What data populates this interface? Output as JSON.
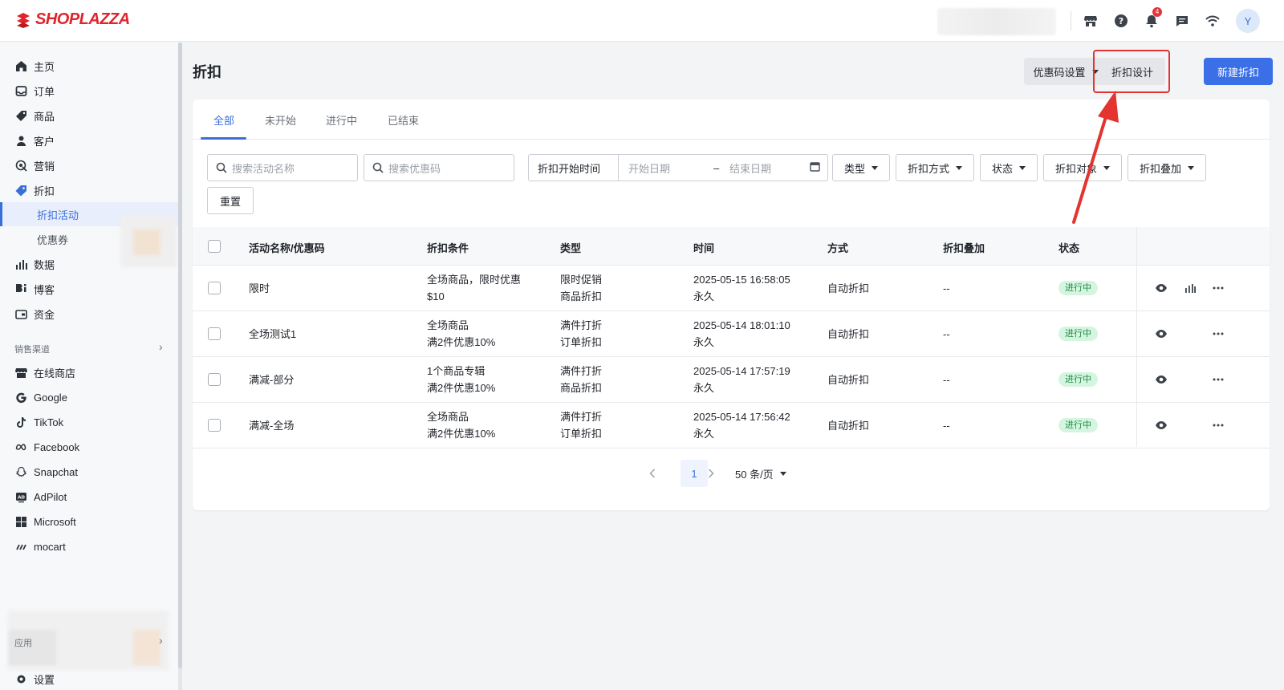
{
  "brand": {
    "name": "SHOPLAZZA",
    "color": "#e0242c"
  },
  "topbar": {
    "icons": [
      "store-icon",
      "help-icon",
      "bell-icon",
      "chat-icon",
      "wifi-icon"
    ],
    "notifications": "4",
    "avatar": "Y"
  },
  "sidebar": {
    "items": [
      {
        "label": "主页",
        "icon": "home-icon"
      },
      {
        "label": "订单",
        "icon": "inbox-icon"
      },
      {
        "label": "商品",
        "icon": "tag-icon"
      },
      {
        "label": "客户",
        "icon": "person-icon"
      },
      {
        "label": "营销",
        "icon": "target-icon"
      },
      {
        "label": "折扣",
        "icon": "discount-icon"
      },
      {
        "label": "折扣活动"
      },
      {
        "label": "优惠券"
      },
      {
        "label": "数据",
        "icon": "bar-chart-icon"
      },
      {
        "label": "博客",
        "icon": "blog-icon"
      },
      {
        "label": "资金",
        "icon": "wallet-icon"
      }
    ],
    "channels_label": "销售渠道",
    "channels": [
      {
        "label": "在线商店",
        "icon": "store-icon"
      },
      {
        "label": "Google",
        "icon": "google-icon"
      },
      {
        "label": "TikTok",
        "icon": "tiktok-icon"
      },
      {
        "label": "Facebook",
        "icon": "meta-icon"
      },
      {
        "label": "Snapchat",
        "icon": "snapchat-icon"
      },
      {
        "label": "AdPilot",
        "icon": "adpilot-icon"
      },
      {
        "label": "Microsoft",
        "icon": "microsoft-icon"
      },
      {
        "label": "mocart",
        "icon": "mocart-icon"
      }
    ],
    "apps_label": "应用",
    "settings_label": "设置"
  },
  "page": {
    "title": "折扣",
    "coupon_settings": "优惠码设置",
    "discount_design": "折扣设计",
    "new_discount": "新建折扣"
  },
  "tabs": [
    "全部",
    "未开始",
    "进行中",
    "已结束"
  ],
  "filters": {
    "search_name": "搜索活动名称",
    "search_code": "搜索优惠码",
    "date_label": "折扣开始时间",
    "start_date": "开始日期",
    "date_sep": "–",
    "end_date": "结束日期",
    "type": "类型",
    "method": "折扣方式",
    "status": "状态",
    "target": "折扣对象",
    "stacking": "折扣叠加",
    "reset": "重置"
  },
  "table": {
    "headers": [
      "活动名称/优惠码",
      "折扣条件",
      "类型",
      "时间",
      "方式",
      "折扣叠加",
      "状态"
    ],
    "rows": [
      {
        "name": "限时",
        "cond1": "全场商品，限时优惠",
        "cond2": "$10",
        "type1": "限时促销",
        "type2": "商品折扣",
        "time1": "2025-05-15 16:58:05",
        "time2": "永久",
        "method": "自动折扣",
        "stacking": "--",
        "status": "进行中"
      },
      {
        "name": "全场测试1",
        "cond1": "全场商品",
        "cond2": "满2件优惠10%",
        "type1": "满件打折",
        "type2": "订单折扣",
        "time1": "2025-05-14 18:01:10",
        "time2": "永久",
        "method": "自动折扣",
        "stacking": "--",
        "status": "进行中"
      },
      {
        "name": "满减-部分",
        "cond1": "1个商品专辑",
        "cond2": "满2件优惠10%",
        "type1": "满件打折",
        "type2": "商品折扣",
        "time1": "2025-05-14 17:57:19",
        "time2": "永久",
        "method": "自动折扣",
        "stacking": "--",
        "status": "进行中"
      },
      {
        "name": "满减-全场",
        "cond1": "全场商品",
        "cond2": "满2件优惠10%",
        "type1": "满件打折",
        "type2": "订单折扣",
        "time1": "2025-05-14 17:56:42",
        "time2": "永久",
        "method": "自动折扣",
        "stacking": "--",
        "status": "进行中"
      }
    ]
  },
  "pagination": {
    "current": "1",
    "per_page": "50 条/页"
  },
  "colors": {
    "primary": "#3a6fe8",
    "status_bg": "#d6f5e0",
    "status_fg": "#1c8c45",
    "annotation": "#e3342f"
  }
}
